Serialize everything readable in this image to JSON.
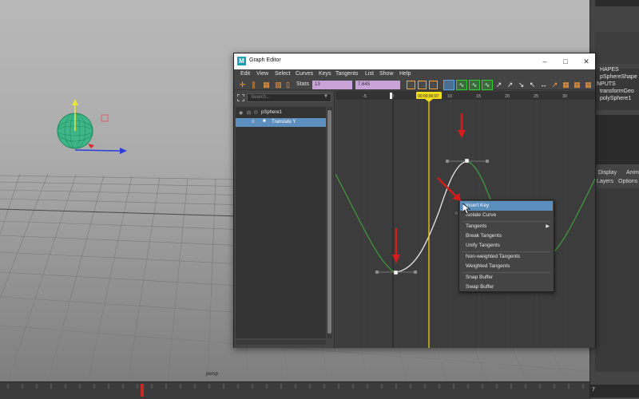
{
  "viewport": {
    "camera_label": "persp"
  },
  "right_panel": {
    "lines": [
      "HAPES",
      "pSphereShape",
      "NPUTS",
      "transformGeo",
      "polySphere1"
    ],
    "tabs": [
      "Display",
      "Anim"
    ],
    "subtabs": [
      "Layers",
      "Options"
    ]
  },
  "timeline": {
    "current_frame_field": "7"
  },
  "graph_editor": {
    "title": "Graph Editor",
    "menu": [
      "Edit",
      "View",
      "Select",
      "Curves",
      "Keys",
      "Tangents",
      "List",
      "Show",
      "Help"
    ],
    "stats_label": "Stats",
    "stats_field_1": "13",
    "stats_field_2": "7.645",
    "search_placeholder": "Search...",
    "outliner": [
      {
        "label": "pSphere1"
      },
      {
        "label": "Translate Y"
      }
    ],
    "ruler_ticks": [
      "-5",
      "0",
      "5",
      "10",
      "15",
      "20",
      "25",
      "30"
    ],
    "current_time": "00:00:00:07",
    "colors": {
      "curve_green": "#3f9c3f",
      "curve_white": "#e8e8e8",
      "time_cursor": "#e6d21a",
      "selection": "#5c8fbd",
      "annotation_red": "#d41c1c"
    }
  },
  "context_menu": {
    "items": [
      {
        "label": "Insert Key"
      },
      {
        "label": "Isolate Curve"
      },
      {
        "label": "Tangents"
      },
      {
        "label": "Break Tangents"
      },
      {
        "label": "Unify Tangents"
      },
      {
        "label": "Non-weighted Tangents"
      },
      {
        "label": "Weighted Tangents"
      },
      {
        "label": "Snap Buffer"
      },
      {
        "label": "Swap Buffer"
      }
    ]
  }
}
